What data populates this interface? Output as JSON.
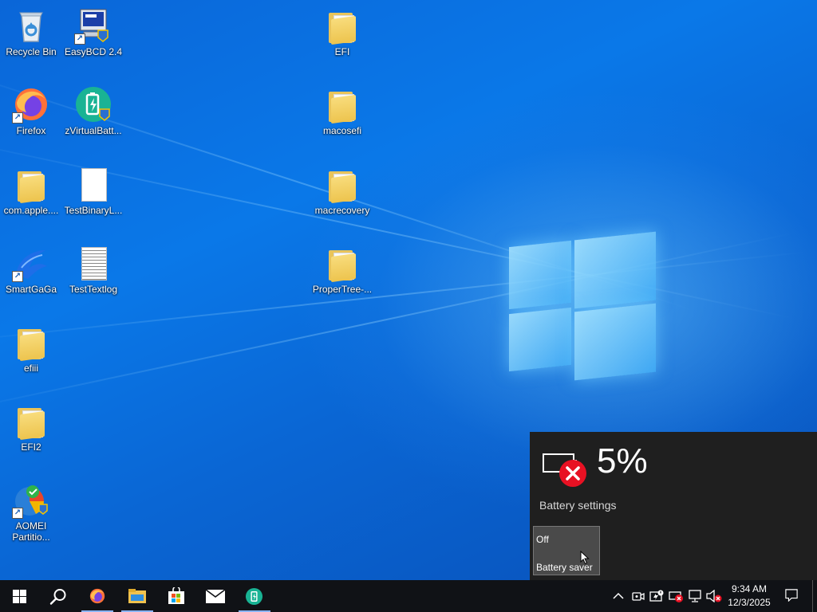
{
  "desktop": {
    "icons": [
      {
        "name": "recycle-bin",
        "label": "Recycle Bin"
      },
      {
        "name": "easybcd",
        "label": "EasyBCD 2.4"
      },
      {
        "name": "efi-folder",
        "label": "EFI"
      },
      {
        "name": "firefox",
        "label": "Firefox"
      },
      {
        "name": "zvirtualbattery",
        "label": "zVirtualBatt..."
      },
      {
        "name": "macosefi-folder",
        "label": "macosefi"
      },
      {
        "name": "com-apple-folder",
        "label": "com.apple...."
      },
      {
        "name": "testbinarylog",
        "label": "TestBinaryL..."
      },
      {
        "name": "macrecovery-folder",
        "label": "macrecovery"
      },
      {
        "name": "smartgaga",
        "label": "SmartGaGa"
      },
      {
        "name": "testtextlog",
        "label": "TestTextlog"
      },
      {
        "name": "propertree-folder",
        "label": "ProperTree-..."
      },
      {
        "name": "efiii-folder",
        "label": "efiii"
      },
      {
        "name": "efi2-folder",
        "label": "EFI2"
      },
      {
        "name": "aomei",
        "label": "AOMEI Partitio..."
      }
    ]
  },
  "battery_flyout": {
    "percent": "5%",
    "settings_link": "Battery settings",
    "battery_saver": {
      "state": "Off",
      "label": "Battery saver"
    }
  },
  "taskbar": {
    "buttons": [
      "start-icon",
      "search-icon",
      "firefox-icon",
      "file-explorer-icon",
      "microsoft-store-icon",
      "mail-icon",
      "zvirtualbattery-icon"
    ],
    "tray_icons": [
      "show-hidden-icons-chevron",
      "meet-now-icon",
      "battery-tray-icon",
      "battery-error-icon",
      "network-icon",
      "volume-muted-icon"
    ],
    "clock": {
      "time": "9:34 AM",
      "date": "12/3/2025"
    }
  },
  "colors": {
    "taskbar": "#101216",
    "flyout": "#1f1f1f",
    "error_red": "#e81123",
    "accent": "#0a78e8"
  }
}
